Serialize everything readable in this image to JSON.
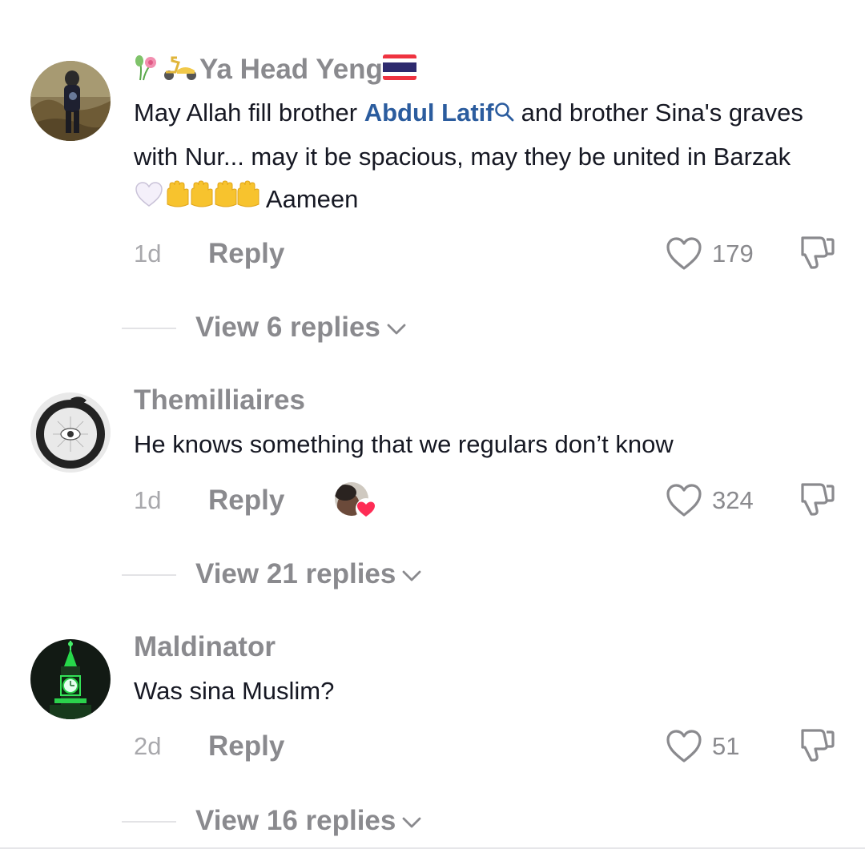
{
  "comments": [
    {
      "username": "Ya Head Yeng",
      "text_before": "May Allah fill brother ",
      "mention": "Abdul Latif",
      "text_after": "and brother Sina's graves with Nur... may it be spacious, may they be united in Barzak",
      "text_tail": "Aameen",
      "time": "1d",
      "reply_label": "Reply",
      "likes": "179",
      "view_replies": "View 6 replies"
    },
    {
      "username": "Themilliaires",
      "text": "He knows something that we regulars don’t know",
      "time": "1d",
      "reply_label": "Reply",
      "likes": "324",
      "view_replies": "View 21 replies"
    },
    {
      "username": "Maldinator",
      "text": "Was sina Muslim?",
      "time": "2d",
      "reply_label": "Reply",
      "likes": "51",
      "view_replies": "View 16 replies"
    }
  ],
  "icons": {
    "like": "heart-outline-icon",
    "dislike": "thumbs-down-icon",
    "expand": "chevron-down-icon",
    "mention_search": "search-icon",
    "creator_liked": "heart-badge-icon"
  },
  "colors": {
    "mention": "#2b5c9e",
    "muted_text": "#8a8a8e",
    "body_text": "#161823",
    "creator_heart": "#fe2c55"
  }
}
